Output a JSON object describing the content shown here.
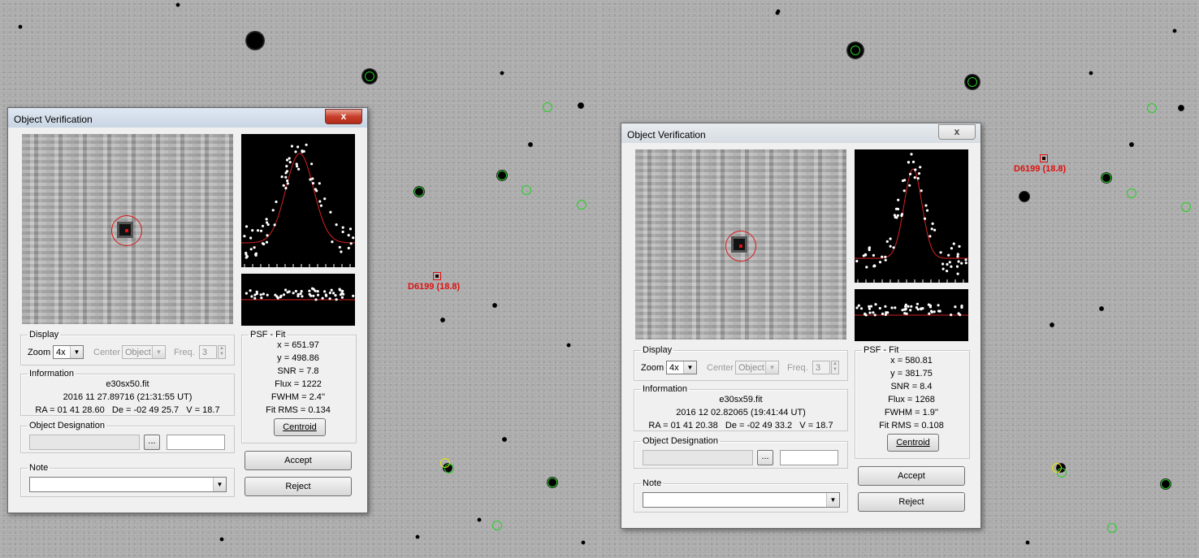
{
  "dialogs": [
    {
      "title": "Object Verification",
      "close_label": "x",
      "display": {
        "legend": "Display",
        "zoom_label": "Zoom",
        "zoom_value": "4x",
        "center_label": "Center",
        "center_value": "Object",
        "freq_label": "Freq.",
        "freq_value": "3"
      },
      "information": {
        "legend": "Information",
        "filename": "e30sx50.fit",
        "date": "2016 11 27.89716 (21:31:55 UT)",
        "coords": "RA = 01 41 28.60   De = -02 49 25.7   V = 18.7"
      },
      "designation": {
        "legend": "Object Designation",
        "browse_label": "..."
      },
      "note": {
        "legend": "Note"
      },
      "psf": {
        "legend": "PSF - Fit",
        "x": "x = 651.97",
        "y": "y = 498.86",
        "snr": "SNR = 7.8",
        "flux": "Flux = 1222",
        "fwhm": "FWHM = 2.4''",
        "fitrms": "Fit RMS = 0.134",
        "centroid_label": "Centroid"
      },
      "accept_label": "Accept",
      "reject_label": "Reject"
    },
    {
      "title": "Object Verification",
      "close_label": "x",
      "display": {
        "legend": "Display",
        "zoom_label": "Zoom",
        "zoom_value": "4x",
        "center_label": "Center",
        "center_value": "Object",
        "freq_label": "Freq.",
        "freq_value": "3"
      },
      "information": {
        "legend": "Information",
        "filename": "e30sx59.fit",
        "date": "2016 12 02.82065 (19:41:44 UT)",
        "coords": "RA = 01 41 20.38   De = -02 49 33.2   V = 18.7"
      },
      "designation": {
        "legend": "Object Designation",
        "browse_label": "..."
      },
      "note": {
        "legend": "Note"
      },
      "psf": {
        "legend": "PSF - Fit",
        "x": "x = 580.81",
        "y": "y = 381.75",
        "snr": "SNR = 8.4",
        "flux": "Flux = 1268",
        "fwhm": "FWHM = 1.9''",
        "fitrms": "Fit RMS = 0.108",
        "centroid_label": "Centroid"
      },
      "accept_label": "Accept",
      "reject_label": "Reject"
    }
  ],
  "targets": [
    {
      "label": "D6199 (18.8)"
    },
    {
      "label": "D6199 (18.8)"
    }
  ],
  "colors": {
    "target_red": "#e01010",
    "ring_green": "#25d025",
    "ring_yellow": "#e6e600",
    "psf_curve": "#d82020",
    "psf_points": "#ffffff"
  }
}
